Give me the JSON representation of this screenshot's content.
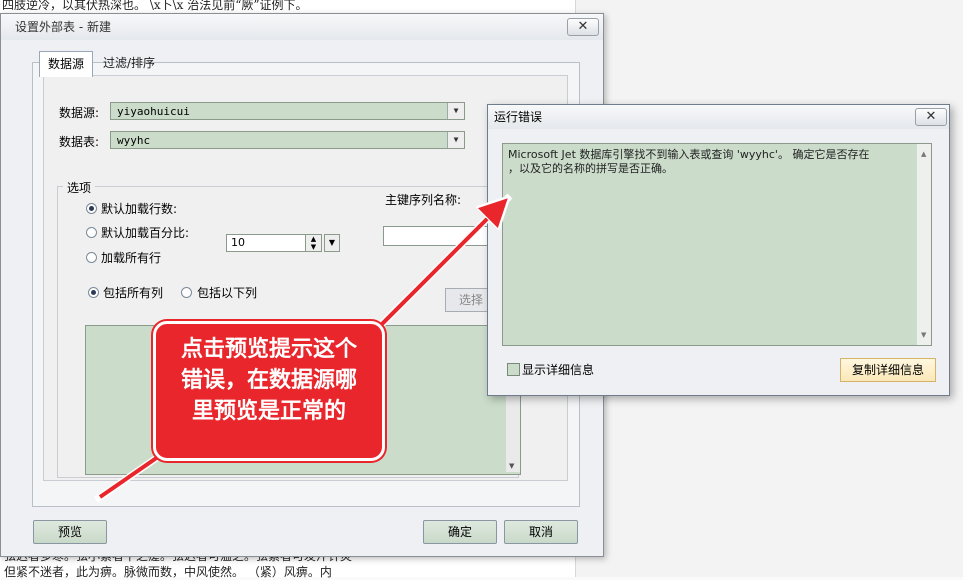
{
  "background": {
    "top_text": "四肢逆冷，以其伏热深也。        \\x卜\\x  治法见前“厥”证例下。",
    "margin_chars": [
      "以",
      "看",
      "",
      "背",
      "纪",
      "赤",
      "职",
      "今",
      "",
      "方",
      "条",
      "时",
      "者",
      "病",
      "者",
      "泠",
      "侵",
      "由",
      "发",
      "冷",
      "。",
      "，",
      "伍",
      "亥",
      "冫",
      "目",
      "前",
      "田",
      "看",
      "症"
    ],
    "bottom_lines": [
      "弦迟者多寒。弦小紧者下之瘥。弦迟者可温之。弦紧者可发汗针灸",
      "但紧不迷者，此为痹。脉微而数，中风使然。        （紧）风痹。内"
    ]
  },
  "main_dialog": {
    "title": "设置外部表 - 新建",
    "close_glyph": "✕",
    "tabs": [
      {
        "label": "数据源",
        "active": true
      },
      {
        "label": "过滤/排序",
        "active": false
      }
    ],
    "datasource_label": "数据源:",
    "datasource_value": "yiyaohuicui",
    "datatable_label": "数据表:",
    "datatable_value": "wyyhc",
    "options_label": "选项",
    "radio_default_rows": "默认加载行数:",
    "radio_default_pct": "默认加载百分比:",
    "pct_value": "10",
    "radio_all_rows": "加载所有行",
    "pk_label": "主键序列名称:",
    "radio_all_cols": "包括所有列",
    "radio_these_cols": "包括以下列",
    "select_button": "选择",
    "preview_button": "预览",
    "ok_button": "确定",
    "cancel_button": "取消"
  },
  "error_dialog": {
    "title": "运行错误",
    "close_glyph": "✕",
    "message_line1": "Microsoft Jet 数据库引擎找不到输入表或查询 'wyyhc'。 确定它是否存在",
    "message_line2": "，以及它的名称的拼写是否正确。",
    "show_details_label": "显示详细信息",
    "copy_details_button": "复制详细信息"
  },
  "callout": {
    "lines": [
      "点击预览提示这个",
      "错误，在数据源哪",
      "里预览是正常的"
    ],
    "color": "#e8262b"
  }
}
